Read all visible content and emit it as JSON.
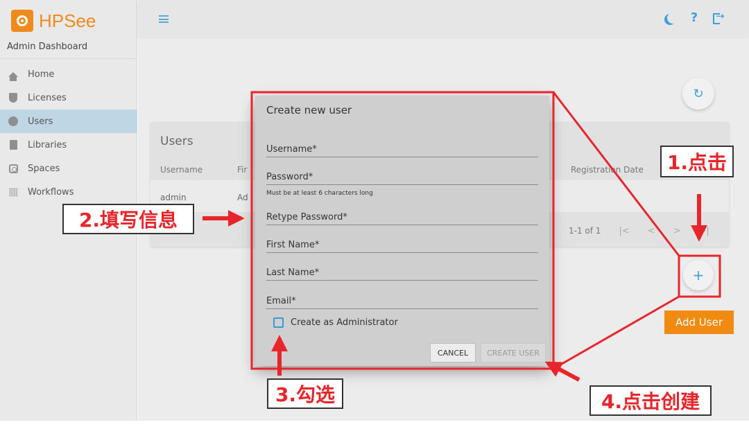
{
  "app": {
    "name": "HPSee",
    "subtitle": "Admin Dashboard"
  },
  "sidebar": {
    "items": [
      {
        "label": "Home",
        "icon": "home-icon"
      },
      {
        "label": "Licenses",
        "icon": "shield-icon"
      },
      {
        "label": "Users",
        "icon": "users-icon",
        "active": true
      },
      {
        "label": "Libraries",
        "icon": "book-icon"
      },
      {
        "label": "Spaces",
        "icon": "spaces-icon"
      },
      {
        "label": "Workflows",
        "icon": "grid-icon"
      }
    ]
  },
  "topbar": {
    "icons": [
      "menu-icon",
      "moon-icon",
      "help-icon",
      "logout-icon"
    ],
    "help_glyph": "?"
  },
  "users_card": {
    "title": "Users",
    "columns": [
      "Username",
      "Fir",
      "Registration Date"
    ],
    "rows": [
      {
        "username": "admin",
        "first": "Ad"
      }
    ],
    "pagination": {
      "range": "1-1 of 1",
      "first": "|<",
      "prev": "<",
      "next": ">",
      "last": ">|"
    }
  },
  "fab": {
    "refresh_glyph": "↻",
    "add_glyph": "+",
    "add_label": "Add User"
  },
  "dialog": {
    "title": "Create new user",
    "fields": {
      "username": "Username*",
      "password": "Password*",
      "password_hint": "Must be at least 6 characters long",
      "retype": "Retype Password*",
      "first_name": "First Name*",
      "last_name": "Last Name*",
      "email": "Email*"
    },
    "checkbox_label": "Create as Administrator",
    "cancel": "CANCEL",
    "create": "CREATE USER"
  },
  "annotations": {
    "step1": "1.点击",
    "step2": "2.填写信息",
    "step3": "3.勾选",
    "step4": "4.点击创建"
  },
  "colors": {
    "accent": "#3aa0e0",
    "brand": "#f08a1c",
    "annotation": "#e8252a"
  }
}
